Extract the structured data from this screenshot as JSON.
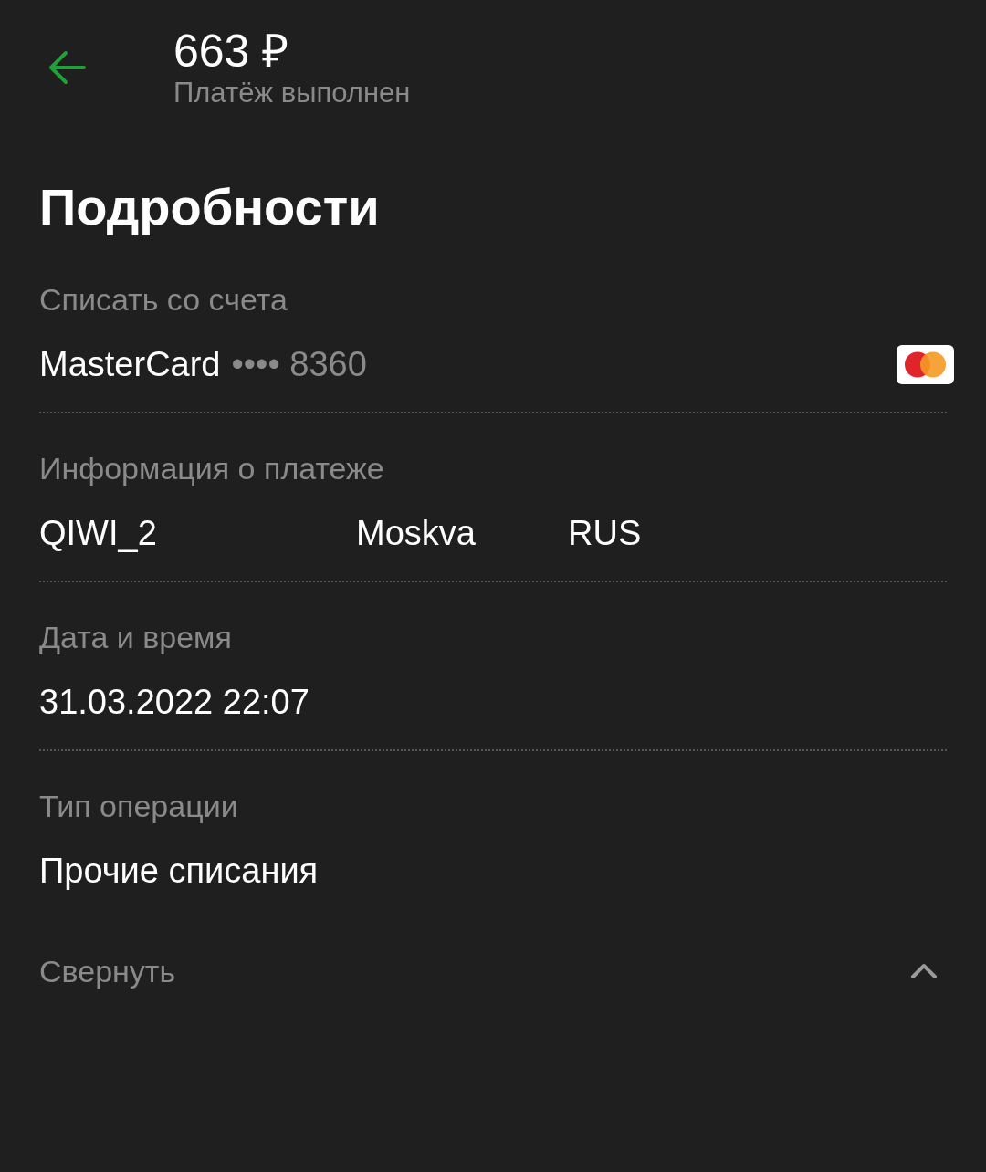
{
  "header": {
    "amount": "663 ₽",
    "status": "Платёж выполнен"
  },
  "title": "Подробности",
  "sections": [
    {
      "kind": "card",
      "label": "Списать со счета",
      "value": "MasterCard",
      "masked": "•••• 8360"
    },
    {
      "kind": "columns",
      "label": "Информация о платеже",
      "values": [
        "QIWI_2",
        "Moskva",
        "RUS"
      ]
    },
    {
      "kind": "text",
      "label": "Дата и время",
      "value": "31.03.2022 22:07"
    },
    {
      "kind": "text",
      "label": "Тип операции",
      "value": "Прочие списания"
    }
  ],
  "collapse": {
    "label": "Свернуть",
    "expanded": true
  }
}
